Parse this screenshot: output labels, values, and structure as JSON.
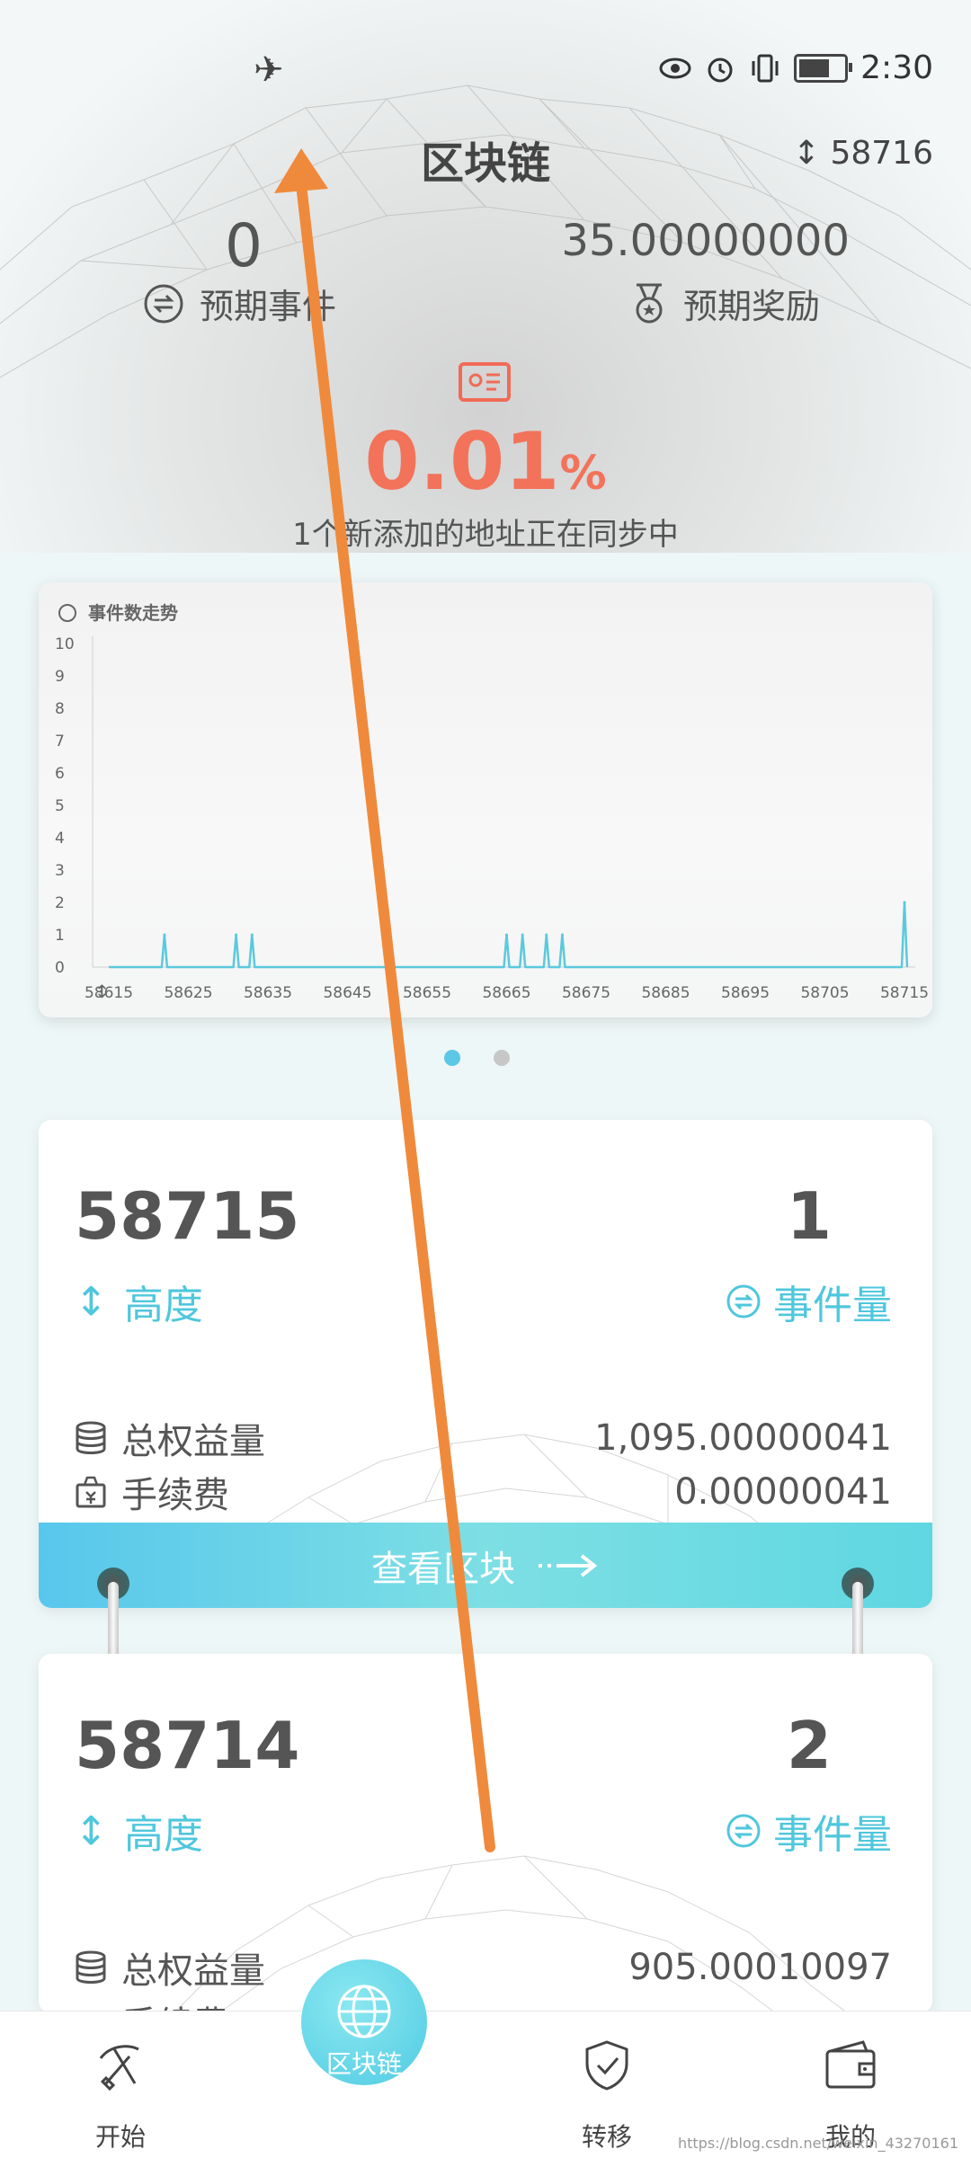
{
  "status_bar": {
    "time": "2:30"
  },
  "header": {
    "title": "区块链",
    "height_value": "58716",
    "expected_events_value": "0",
    "expected_events_label": "预期事件",
    "expected_reward_value": "35.00000000",
    "expected_reward_label": "预期奖励",
    "sync_percent": "0.01",
    "sync_percent_unit": "%",
    "sync_message": "1个新添加的地址正在同步中"
  },
  "chart_data": {
    "type": "line",
    "title": "事件数走势",
    "x": [
      58615,
      58616,
      58617,
      58618,
      58619,
      58620,
      58621,
      58622,
      58623,
      58624,
      58625,
      58626,
      58627,
      58628,
      58629,
      58630,
      58631,
      58632,
      58633,
      58634,
      58635,
      58636,
      58637,
      58638,
      58639,
      58640,
      58641,
      58642,
      58643,
      58644,
      58645,
      58646,
      58647,
      58648,
      58649,
      58650,
      58651,
      58652,
      58653,
      58654,
      58655,
      58656,
      58657,
      58658,
      58659,
      58660,
      58661,
      58662,
      58663,
      58664,
      58665,
      58666,
      58667,
      58668,
      58669,
      58670,
      58671,
      58672,
      58673,
      58674,
      58675,
      58676,
      58677,
      58678,
      58679,
      58680,
      58681,
      58682,
      58683,
      58684,
      58685,
      58686,
      58687,
      58688,
      58689,
      58690,
      58691,
      58692,
      58693,
      58694,
      58695,
      58696,
      58697,
      58698,
      58699,
      58700,
      58701,
      58702,
      58703,
      58704,
      58705,
      58706,
      58707,
      58708,
      58709,
      58710,
      58711,
      58712,
      58713,
      58714,
      58715
    ],
    "series": [
      {
        "values": [
          0,
          0,
          0,
          0,
          0,
          0,
          0,
          1,
          0,
          0,
          0,
          0,
          0,
          0,
          0,
          0,
          1,
          0,
          1,
          0,
          0,
          0,
          0,
          0,
          0,
          0,
          0,
          0,
          0,
          0,
          0,
          0,
          0,
          0,
          0,
          0,
          0,
          0,
          0,
          0,
          0,
          0,
          0,
          0,
          0,
          0,
          0,
          0,
          0,
          0,
          1,
          0,
          1,
          0,
          0,
          1,
          0,
          1,
          0,
          0,
          0,
          0,
          0,
          0,
          0,
          0,
          0,
          0,
          0,
          0,
          0,
          0,
          0,
          0,
          0,
          0,
          0,
          0,
          0,
          0,
          0,
          0,
          0,
          0,
          0,
          0,
          0,
          0,
          0,
          0,
          0,
          0,
          0,
          0,
          0,
          0,
          0,
          0,
          0,
          0,
          2
        ]
      }
    ],
    "xticks": [
      "58615",
      "58625",
      "58635",
      "58645",
      "58655",
      "58665",
      "58675",
      "58685",
      "58695",
      "58705",
      "58715"
    ],
    "yticks": [
      "0",
      "1",
      "2",
      "3",
      "4",
      "5",
      "6",
      "7",
      "8",
      "9",
      "10"
    ],
    "ylim": [
      0,
      10
    ],
    "color": "#5bc9dd"
  },
  "blocks": [
    {
      "height": "58715",
      "height_label": "高度",
      "events": "1",
      "events_label": "事件量",
      "total_equity_label": "总权益量",
      "total_equity": "1,095.00000041",
      "fee_label": "手续费",
      "fee": "0.00000041"
    },
    {
      "height": "58714",
      "height_label": "高度",
      "events": "2",
      "events_label": "事件量",
      "total_equity_label": "总权益量",
      "total_equity": "905.00010097",
      "fee_label": "手续费"
    }
  ],
  "view_block_label": "查看区块",
  "nav": {
    "start": "开始",
    "blockchain": "区块链",
    "transfer": "转移",
    "mine": "我的"
  },
  "watermark": "https://blog.csdn.net/weixin_43270161",
  "colors": {
    "accent": "#4fc7dc",
    "percent": "#f2735a",
    "annotation_arrow": "#ef8a3c"
  }
}
